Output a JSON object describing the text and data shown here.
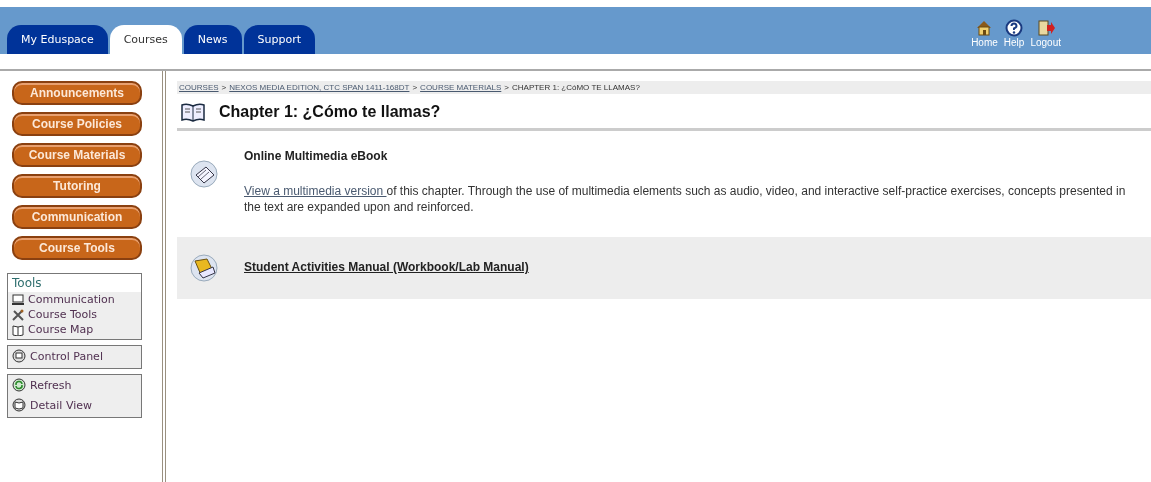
{
  "tabs": [
    {
      "label": "My Eduspace",
      "selected": false
    },
    {
      "label": "Courses",
      "selected": true
    },
    {
      "label": "News",
      "selected": false
    },
    {
      "label": "Support",
      "selected": false
    }
  ],
  "top_links": [
    "Home",
    "Help",
    "Logout"
  ],
  "nav_buttons": [
    "Announcements",
    "Course Policies",
    "Course Materials",
    "Tutoring",
    "Communication",
    "Course Tools"
  ],
  "tools": {
    "title": "Tools",
    "items": [
      "Communication",
      "Course Tools",
      "Course Map"
    ]
  },
  "panels": [
    {
      "items": [
        "Control Panel"
      ]
    },
    {
      "items": [
        "Refresh",
        "Detail View"
      ]
    }
  ],
  "breadcrumb": {
    "separator": ">",
    "items": [
      {
        "label": "COURSES",
        "link": true
      },
      {
        "label": "NEXOS MEDIA EDITION, CTC SPAN 1411-168DT",
        "link": true
      },
      {
        "label": "COURSE MATERIALS",
        "link": true
      },
      {
        "label": "CHAPTER 1: ¿CóMO TE LLAMAS?",
        "link": false
      }
    ]
  },
  "page_title": "Chapter 1: ¿Cómo te llamas?",
  "entries": [
    {
      "kind": "description",
      "title": "Online Multimedia eBook",
      "link": "View a multimedia version ",
      "text": "of this chapter. Through the use of multimedia elements such as audio, video, and interactive self-practice exercises, concepts presented in the text are expanded upon and reinforced."
    },
    {
      "kind": "link",
      "title": "Student Activities Manual (Workbook/Lab Manual)"
    }
  ]
}
